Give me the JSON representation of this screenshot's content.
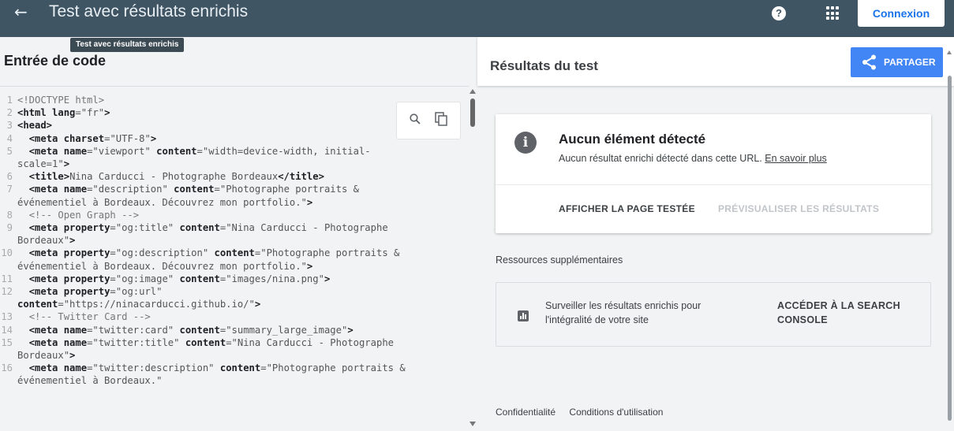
{
  "topbar": {
    "back_icon": "arrow-left-icon",
    "title": "Test avec résultats enrichis",
    "help_icon": "help-circle-icon",
    "help_glyph": "?",
    "apps_icon": "apps-grid-icon",
    "login_label": "Connexion"
  },
  "tooltip": "Test avec résultats enrichis",
  "code_panel": {
    "title": "Entrée de code",
    "lines": [
      {
        "n": "1",
        "html": "<span class='cmt'>&lt;!DOCTYPE html&gt;</span>"
      },
      {
        "n": "2",
        "html": "<span class='tag'>&lt;html</span> <span class='attr'>lang</span>=<span class='str'>\"fr\"</span><span class='tag'>&gt;</span>"
      },
      {
        "n": "3",
        "html": "<span class='tag'>&lt;head&gt;</span>"
      },
      {
        "n": "4",
        "html": "  <span class='tag'>&lt;meta</span> <span class='attr'>charset</span>=<span class='str'>\"UTF-8\"</span><span class='tag'>&gt;</span>"
      },
      {
        "n": "5",
        "html": "  <span class='tag'>&lt;meta</span> <span class='attr'>name</span>=<span class='str'>\"viewport\"</span> <span class='attr'>content</span>=<span class='str'>\"width=device-width, initial-\nscale=1\"</span><span class='tag'>&gt;</span>"
      },
      {
        "n": "6",
        "html": "  <span class='tag'>&lt;title&gt;</span>Nina Carducci - Photographe Bordeaux<span class='tag'>&lt;/title&gt;</span>"
      },
      {
        "n": "7",
        "html": "  <span class='tag'>&lt;meta</span> <span class='attr'>name</span>=<span class='str'>\"description\"</span> <span class='attr'>content</span>=<span class='str'>\"Photographe portraits &amp;\névénementiel à Bordeaux. Découvrez mon portfolio.\"</span><span class='tag'>&gt;</span>"
      },
      {
        "n": "8",
        "html": "  <span class='cmt'>&lt;!-- Open Graph --&gt;</span>"
      },
      {
        "n": "9",
        "html": "  <span class='tag'>&lt;meta</span> <span class='attr'>property</span>=<span class='str'>\"og:title\"</span> <span class='attr'>content</span>=<span class='str'>\"Nina Carducci - Photographe\nBordeaux\"</span><span class='tag'>&gt;</span>"
      },
      {
        "n": "10",
        "html": "  <span class='tag'>&lt;meta</span> <span class='attr'>property</span>=<span class='str'>\"og:description\"</span> <span class='attr'>content</span>=<span class='str'>\"Photographe portraits &amp;\névénementiel à Bordeaux. Découvrez mon portfolio.\"</span><span class='tag'>&gt;</span>"
      },
      {
        "n": "11",
        "html": "  <span class='tag'>&lt;meta</span> <span class='attr'>property</span>=<span class='str'>\"og:image\"</span> <span class='attr'>content</span>=<span class='str'>\"images/nina.png\"</span><span class='tag'>&gt;</span>"
      },
      {
        "n": "12",
        "html": "  <span class='tag'>&lt;meta</span> <span class='attr'>property</span>=<span class='str'>\"og:url\"</span>\n<span class='attr'>content</span>=<span class='str'>\"https://ninacarducci.github.io/\"</span><span class='tag'>&gt;</span>"
      },
      {
        "n": "13",
        "html": "  <span class='cmt'>&lt;!-- Twitter Card --&gt;</span>"
      },
      {
        "n": "14",
        "html": "  <span class='tag'>&lt;meta</span> <span class='attr'>name</span>=<span class='str'>\"twitter:card\"</span> <span class='attr'>content</span>=<span class='str'>\"summary_large_image\"</span><span class='tag'>&gt;</span>"
      },
      {
        "n": "15",
        "html": "  <span class='tag'>&lt;meta</span> <span class='attr'>name</span>=<span class='str'>\"twitter:title\"</span> <span class='attr'>content</span>=<span class='str'>\"Nina Carducci - Photographe\nBordeaux\"</span><span class='tag'>&gt;</span>"
      },
      {
        "n": "16",
        "html": "  <span class='tag'>&lt;meta</span> <span class='attr'>name</span>=<span class='str'>\"twitter:description\"</span> <span class='attr'>content</span>=<span class='str'>\"Photographe portraits &amp;\névénementiel à Bordeaux.\"</span>"
      }
    ],
    "search_icon": "search-icon",
    "copy_icon": "copy-icon"
  },
  "results_panel": {
    "title": "Résultats du test",
    "share_label": "PARTAGER",
    "share_icon": "share-icon",
    "result_card": {
      "info_icon": "info-icon",
      "info_glyph": "i",
      "heading": "Aucun élément détecté",
      "description": "Aucun résultat enrichi détecté dans cette URL.",
      "learn_more": "En savoir plus",
      "view_page_label": "AFFICHER LA PAGE TESTÉE",
      "preview_label": "PRÉVISUALISER LES RÉSULTATS"
    },
    "resources": {
      "title": "Ressources supplémentaires",
      "chart_icon": "bar-chart-icon",
      "text": "Surveiller les résultats enrichis pour l'intégralité de votre site",
      "link": "ACCÉDER À LA SEARCH CONSOLE"
    },
    "footer": {
      "privacy": "Confidentialité",
      "terms": "Conditions d'utilisation"
    }
  },
  "colors": {
    "topbar": "#3f5564",
    "accent": "#4285f4",
    "panel_bg": "#f1f3f4"
  }
}
